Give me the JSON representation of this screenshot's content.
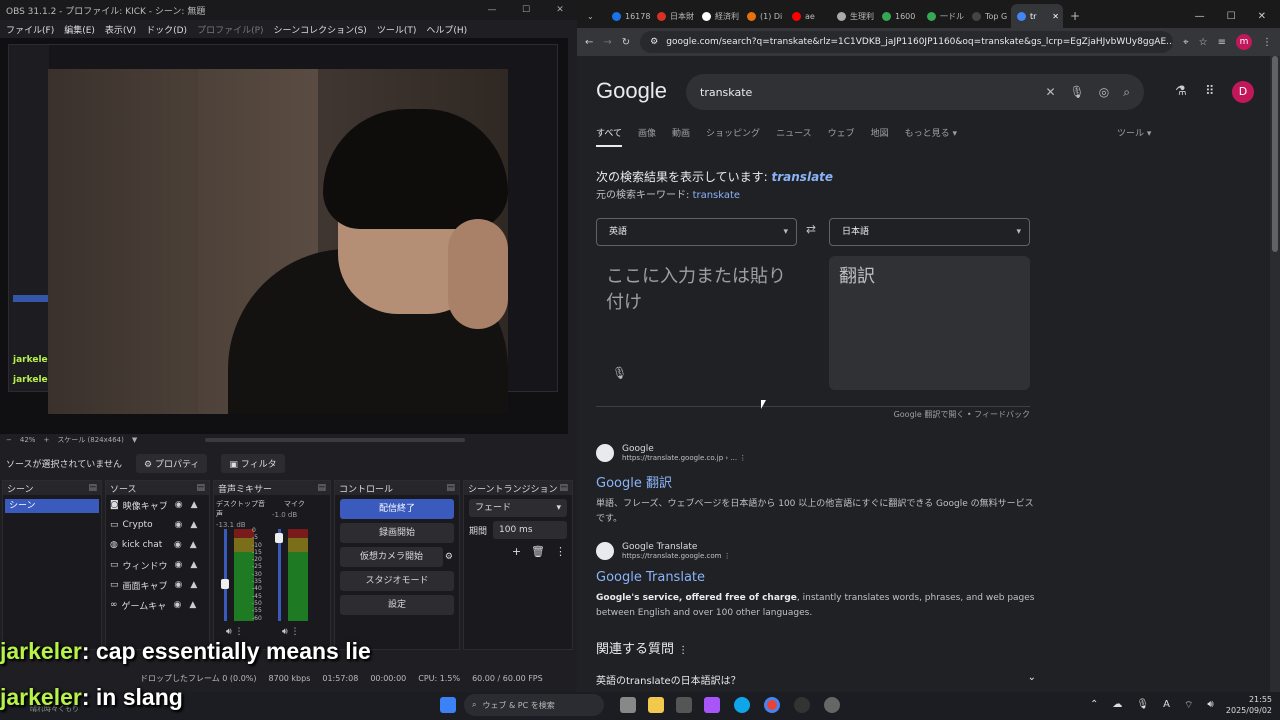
{
  "obs": {
    "title": "OBS 31.1.2 - プロファイル: KICK - シーン: 無題",
    "menu": [
      "ファイル(F)",
      "編集(E)",
      "表示(V)",
      "ドック(D)",
      "プロファイル(P)",
      "シーンコレクション(S)",
      "ツール(T)",
      "ヘルプ(H)"
    ],
    "zoom": "42%",
    "scale": "スケール (824x464)",
    "no_source": "ソースが選択されていません",
    "properties_label": "プロパティ",
    "filters_label": "フィルタ",
    "docks": {
      "scenes": "シーン",
      "sources": "ソース",
      "mixer": "音声ミキサー",
      "controls": "コントロール",
      "transitions": "シーントランジション"
    },
    "scene_item": "シーン",
    "sources": [
      "映像キャプチ",
      "Crypto",
      "kick chat",
      "ウィンドウキャ",
      "画面キャプチ",
      "ゲームキャプ"
    ],
    "mixer": {
      "desktop_label": "デスクトップ音声",
      "desktop_db": "-13.1 dB",
      "mic_label": "マイク",
      "mic_db": "-1.0 dB",
      "scale_ticks": [
        "0",
        "-5",
        "-10",
        "-15",
        "-20",
        "-25",
        "-30",
        "-35",
        "-40",
        "-45",
        "-50",
        "-55",
        "-60"
      ]
    },
    "controls": [
      "配信終了",
      "録画開始",
      "仮想カメラ開始",
      "スタジオモード",
      "設定"
    ],
    "transition": {
      "type": "フェード",
      "duration_label": "期間",
      "duration": "100 ms"
    },
    "status": {
      "dropped": "ドロップしたフレーム 0 (0.0%)",
      "bitrate": "8700 kbps",
      "stream_time": "01:57:08",
      "rec_time": "00:00:00",
      "cpu": "CPU: 1.5%",
      "fps": "60.00 / 60.00 FPS"
    },
    "nested_chat": [
      "jarkeler",
      "jarkeler"
    ]
  },
  "chat": [
    {
      "user": "jarkeler",
      "message": ": cap essentially means lie"
    },
    {
      "user": "jarkeler",
      "message": ": in slang"
    }
  ],
  "chrome": {
    "tabs": [
      "16178",
      "日本財",
      "経済利",
      "(1) Di",
      "ae",
      "生理利",
      "1600",
      "一ドル",
      "Top G",
      "tr"
    ],
    "url": "google.com/search?q=transkate&rlz=1C1VDKB_jaJP1160JP1160&oq=transkate&gs_lcrp=EgZjaHJvbWUy8ggAE...",
    "profile_initial": "m"
  },
  "google": {
    "logo": "Google",
    "query": "transkate",
    "avatar": "D",
    "nav": [
      "すべて",
      "画像",
      "動画",
      "ショッピング",
      "ニュース",
      "ウェブ",
      "地図",
      "もっと見る"
    ],
    "tools": "ツール",
    "showing_prefix": "次の検索結果を表示しています:",
    "corrected": "translate",
    "original_prefix": "元の検索キーワード:",
    "original": "transkate",
    "source_lang": "英語",
    "target_lang": "日本語",
    "input_placeholder": "ここに入力または貼り付け",
    "output_placeholder": "翻訳",
    "open_in_translate": "Google 翻訳で開く",
    "feedback": "フィードバック",
    "results": [
      {
        "site": "Google",
        "url": "https://translate.google.co.jp › ...",
        "title": "Google 翻訳",
        "snippet": "単語、フレーズ、ウェブページを日本語から 100 以上の他言語にすぐに翻訳できる Google の無料サービスです。"
      },
      {
        "site": "Google Translate",
        "url": "https://translate.google.com",
        "title": "Google Translate",
        "snippet_bold": "Google's service, offered free of charge",
        "snippet": ", instantly translates words, phrases, and web pages between English and over 100 other languages."
      }
    ],
    "paa_title": "関連する質問",
    "paa_q1": "英語のtranslateの日本語訳は？"
  },
  "taskbar": {
    "search_placeholder": "ウェブ & PC を検索",
    "time": "21:55",
    "date": "2025/09/02",
    "bottom_left": "晴れ時々くもり"
  }
}
